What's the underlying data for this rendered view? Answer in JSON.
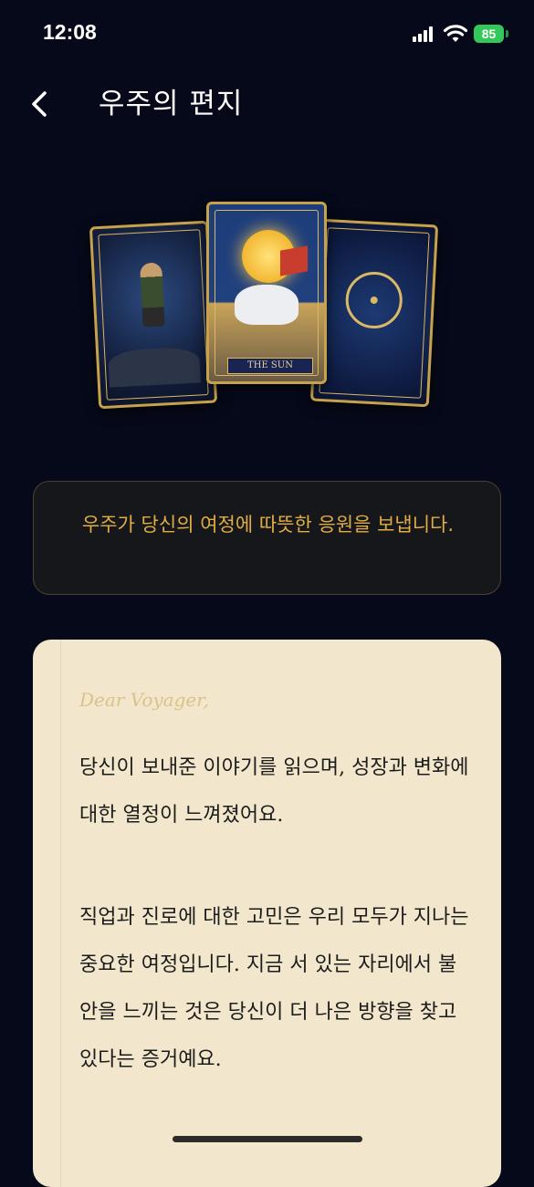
{
  "status": {
    "time": "12:08",
    "battery": "85",
    "icons": [
      "signal-icon",
      "wifi-icon",
      "battery-icon"
    ],
    "battery_color": "#34c759"
  },
  "nav": {
    "title": "우주의 편지",
    "back_icon": "chevron-left-icon"
  },
  "cards": [
    {
      "name": "knight-card"
    },
    {
      "name": "sun-card",
      "label": "THE SUN"
    },
    {
      "name": "wheel-card"
    }
  ],
  "message": {
    "text": "우주가 당신의 여정에 따뜻한 응원을 보냅니다."
  },
  "letter": {
    "greeting": "Dear Voyager,",
    "paragraphs": [
      "당신이 보내준 이야기를 읽으며, 성장과 변화에 대한 열정이 느껴졌어요.",
      "직업과 진로에 대한 고민은 우리 모두가 지나는 중요한 여정입니다. 지금 서 있는 자리에서 불안을 느끼는 것은 당신이 더 나은 방향을 찾고 있다는 증거예요."
    ]
  },
  "colors": {
    "background": "#060919",
    "accent": "#e0ad44",
    "letter_paper": "#f2e7cd",
    "card_border": "#c7a24d"
  }
}
